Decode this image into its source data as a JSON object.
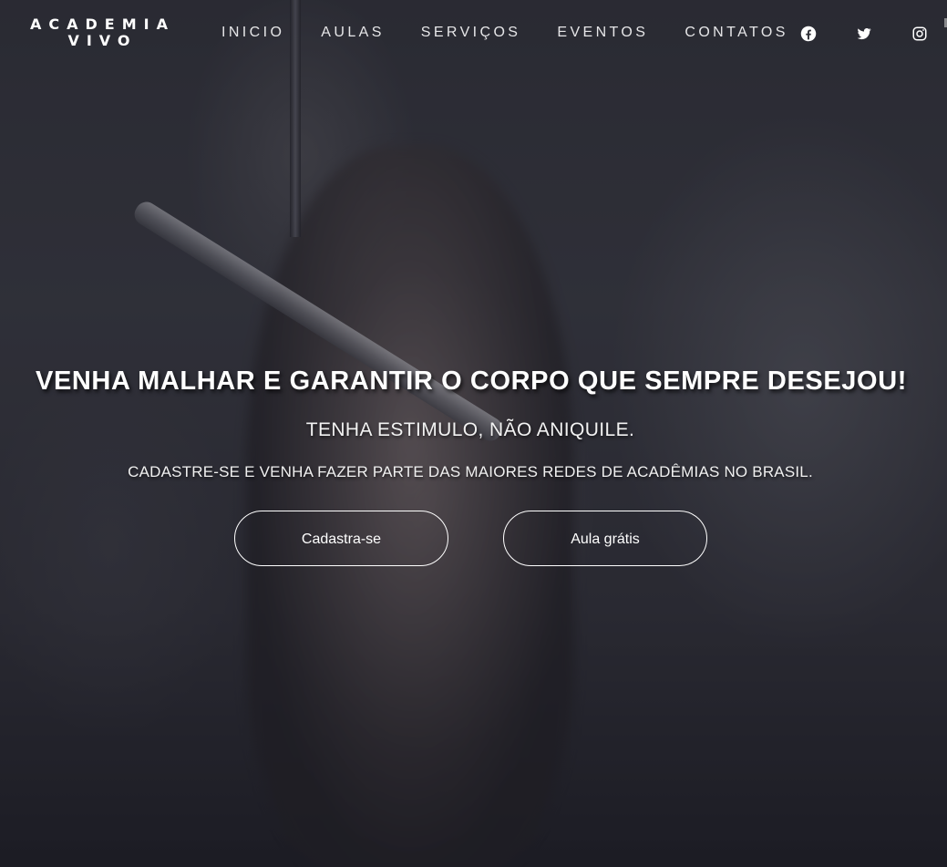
{
  "brand": {
    "line1": "ACADEMIA",
    "line2": "VIVO"
  },
  "nav": {
    "items": [
      {
        "label": "INICIO"
      },
      {
        "label": "AULAS"
      },
      {
        "label": "SERVIÇOS"
      },
      {
        "label": "EVENTOS"
      },
      {
        "label": "CONTATOS"
      }
    ]
  },
  "social": {
    "icons": [
      "facebook-icon",
      "twitter-icon",
      "instagram-icon"
    ]
  },
  "hero": {
    "headline": "VENHA MALHAR E GARANTIR O CORPO QUE SEMPRE DESEJOU!",
    "subheadline": "TENHA ESTIMULO, NÃO ANIQUILE.",
    "tagline": "CADASTRE-SE E VENHA FAZER PARTE DAS MAIORES REDES DE ACADÊMIAS NO BRASIL.",
    "buttons": {
      "signup": "Cadastra-se",
      "trial": "Aula grátis"
    }
  },
  "colors": {
    "overlay": "#14141e",
    "text": "#ffffff",
    "button_border": "#ffffff"
  }
}
